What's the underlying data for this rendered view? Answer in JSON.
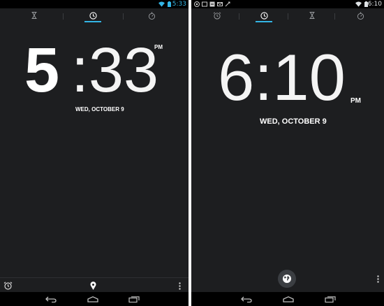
{
  "colors": {
    "accent": "#33b5e5",
    "background": "#1d1e20",
    "text": "#ffffff"
  },
  "left_screen": {
    "status_time": "5:33",
    "tabs": [
      {
        "icon": "hourglass-icon",
        "selected": false
      },
      {
        "icon": "clock-icon",
        "selected": true
      },
      {
        "icon": "stopwatch-icon",
        "selected": false
      }
    ],
    "hour": "5",
    "minutes": ":33",
    "ampm": "PM",
    "date": "WED, OCTOBER 9",
    "bottom_icons": [
      "alarm-icon",
      "location-pin-icon",
      "overflow-menu-icon"
    ]
  },
  "right_screen": {
    "status_time": "6:10",
    "tabs": [
      {
        "icon": "alarm-icon",
        "selected": false
      },
      {
        "icon": "clock-icon",
        "selected": true
      },
      {
        "icon": "hourglass-icon",
        "selected": false
      },
      {
        "icon": "stopwatch-icon",
        "selected": false
      }
    ],
    "time": "6:10",
    "ampm": "PM",
    "date": "WED, OCTOBER 9",
    "bottom_icons": [
      "globe-icon",
      "overflow-menu-icon"
    ]
  },
  "nav_icons": [
    "back-icon",
    "home-icon",
    "recents-icon"
  ]
}
